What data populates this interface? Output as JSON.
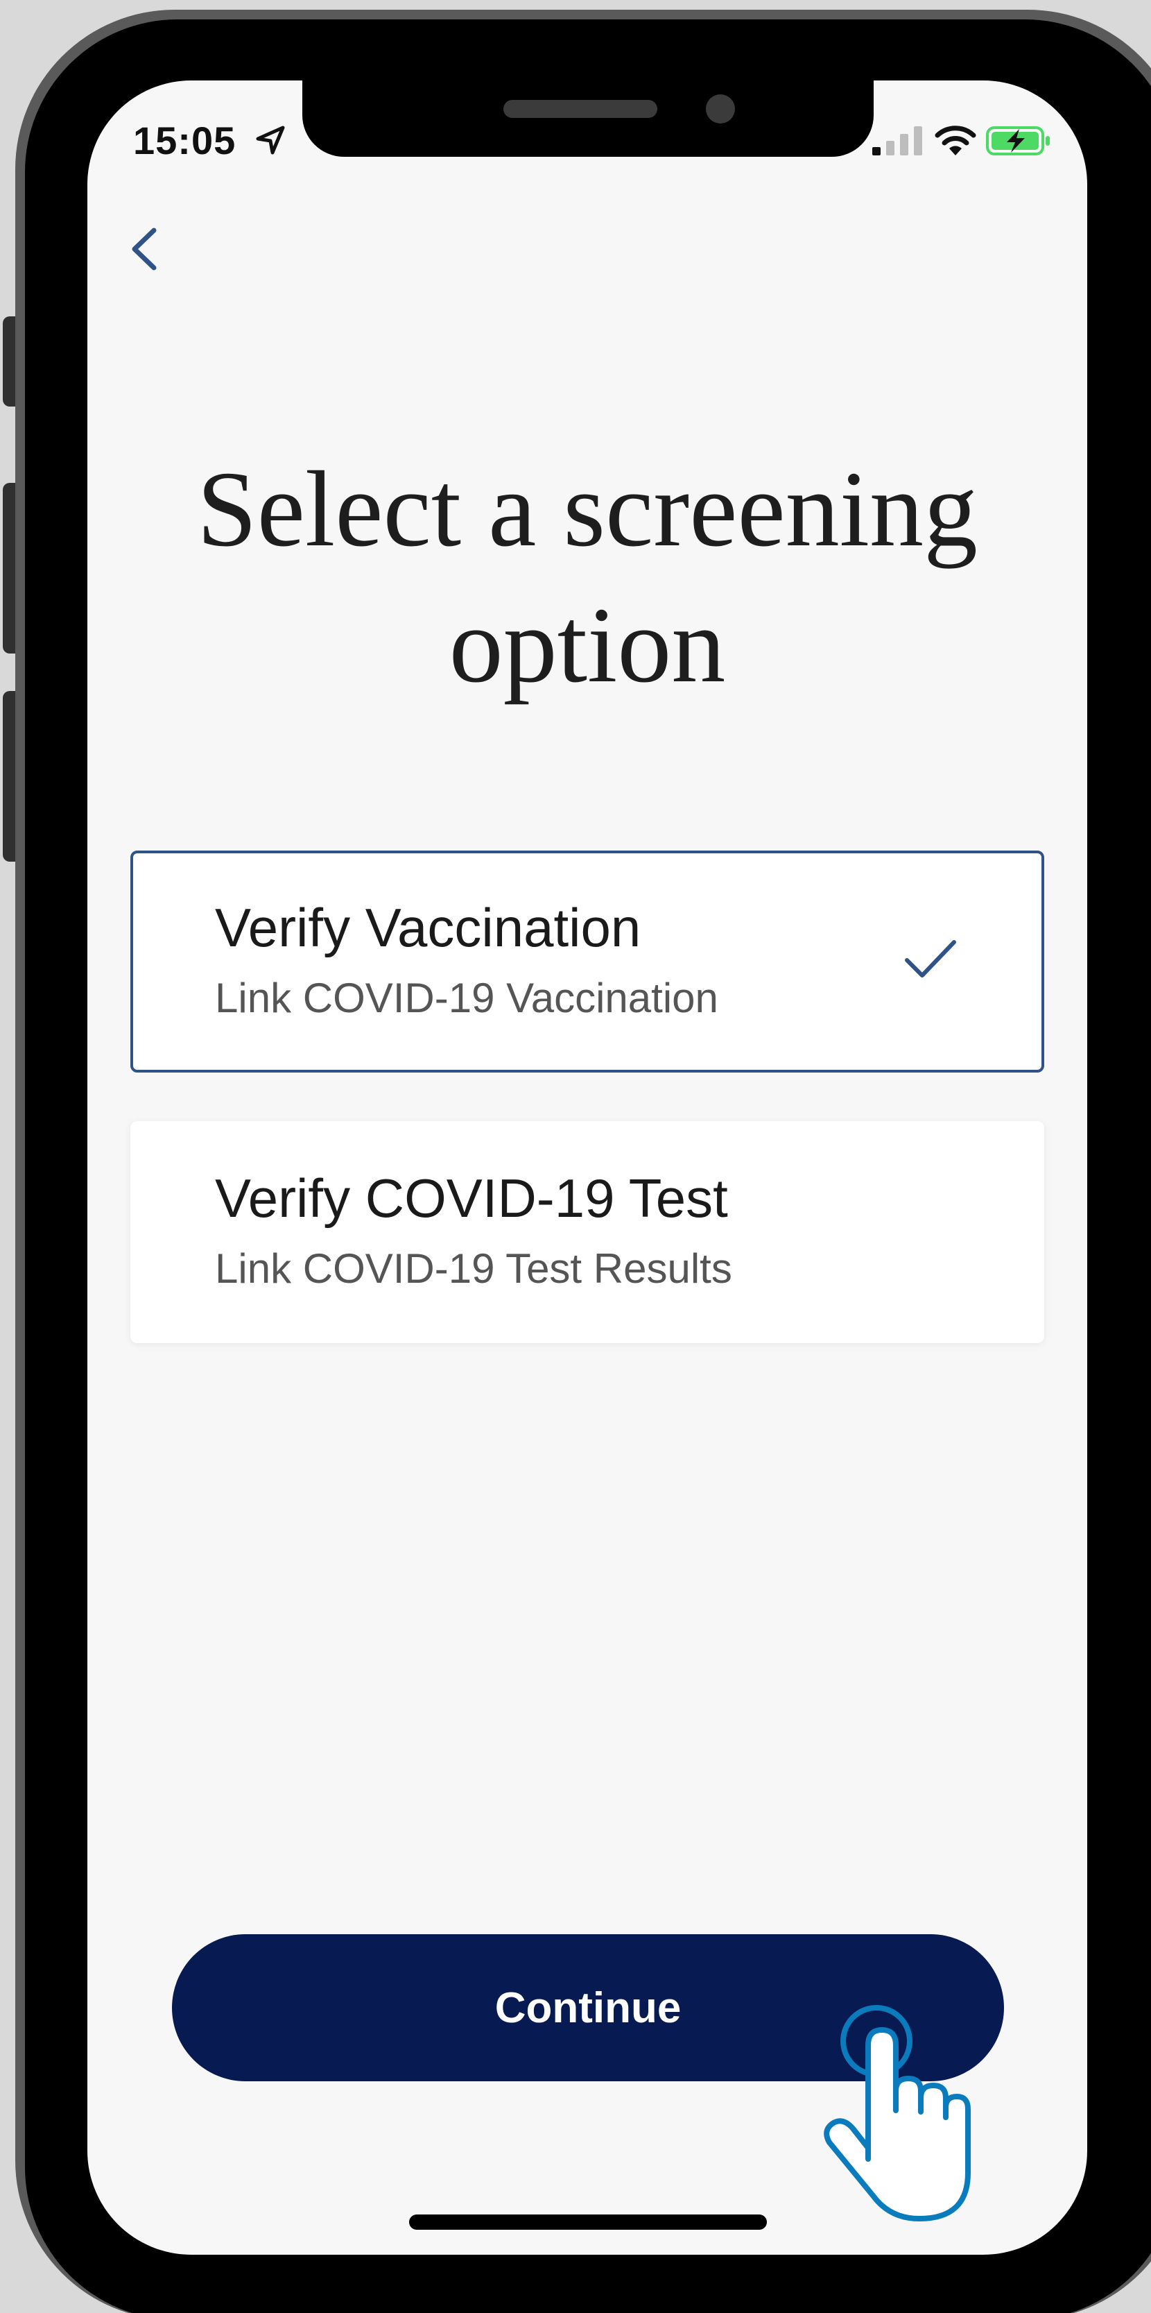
{
  "status_bar": {
    "time": "15:05"
  },
  "header": {
    "back_icon": "chevron-left-icon",
    "title": "Select a screening option"
  },
  "options": [
    {
      "title": "Verify Vaccination",
      "subtitle": "Link COVID-19 Vaccination",
      "selected": true
    },
    {
      "title": "Verify COVID-19 Test",
      "subtitle": "Link COVID-19 Test Results",
      "selected": false
    }
  ],
  "footer": {
    "continue_label": "Continue",
    "tap_hint_icon": "hand-pointer-icon"
  },
  "colors": {
    "accent": "#2f5287",
    "button": "#071a52",
    "background": "#f7f7f8",
    "battery": "#4cd964",
    "tap_hint": "#0a7bbd"
  }
}
